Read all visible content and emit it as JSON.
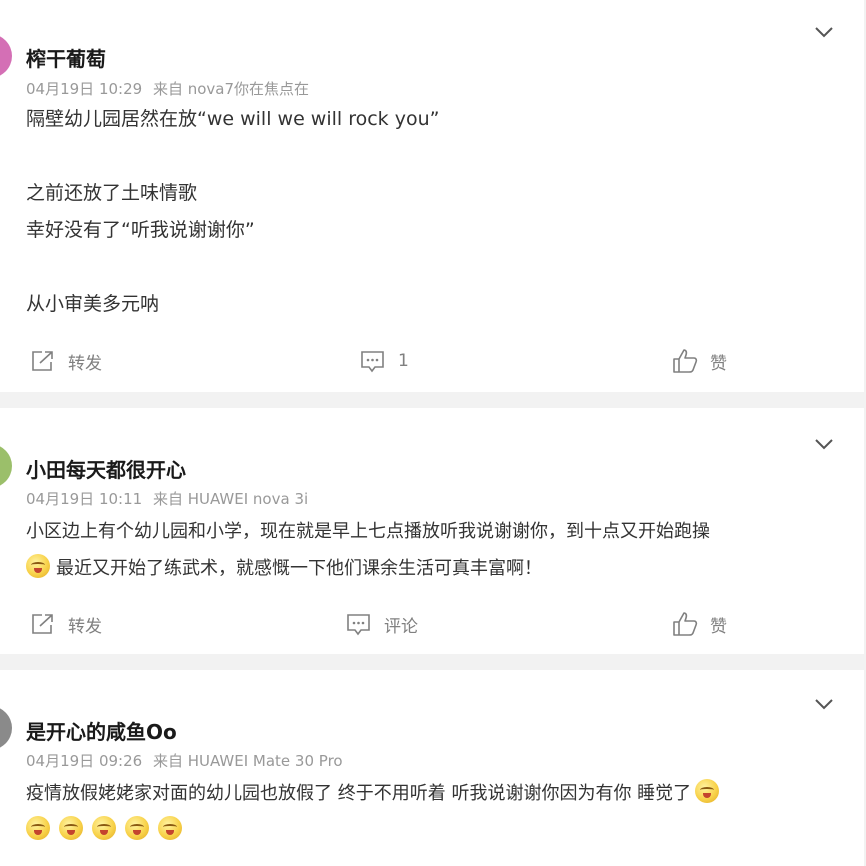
{
  "posts": [
    {
      "username": "榨干葡萄",
      "date": "04月19日 10:29",
      "source": "来自 nova7你在焦点在",
      "avatar_color": "#d46fb5",
      "lines": [
        "隔壁幼儿园居然在放“we will we will rock you”",
        "",
        "之前还放了土味情歌",
        "幸好没有了“听我说谢谢你”",
        "",
        "从小审美多元呐"
      ],
      "actions": {
        "repost": "转发",
        "comment": "1",
        "like": "赞"
      }
    },
    {
      "username": "小田每天都很开心",
      "date": "04月19日 10:11",
      "source": "来自 HUAWEI nova 3i",
      "avatar_color": "#9bbf6a",
      "lines": [
        "小区边上有个幼儿园和小学，现在就是早上七点播放听我说谢谢你，到十点又开始跑操"
      ],
      "line2_text": "最近又开始了练武术，就感慨一下他们课余生活可真丰富啊！",
      "actions": {
        "repost": "转发",
        "comment": "评论",
        "like": "赞"
      }
    },
    {
      "username": "是开心的咸鱼Oo",
      "date": "04月19日 09:26",
      "source": "来自 HUAWEI Mate 30 Pro",
      "avatar_color": "#8a8a8a",
      "lines": [
        "疫情放假姥姥家对面的幼儿园也放假了 终于不用听着 听我说谢谢你因为有你 睡觉了"
      ],
      "emoji_count": 5
    }
  ],
  "icons": {
    "chevron": "chevron-down-icon",
    "repost": "repost-icon",
    "comment": "comment-icon",
    "like": "thumbs-up-icon",
    "emoji": "smiley-emoji-icon"
  }
}
